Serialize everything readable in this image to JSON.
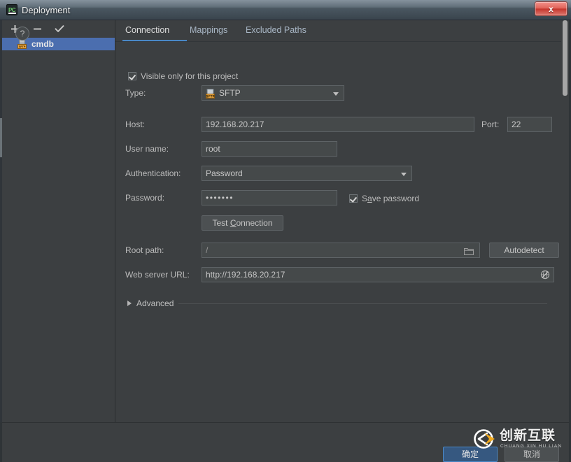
{
  "window": {
    "title": "Deployment",
    "app_icon": "pycharm-icon",
    "close_label": "x"
  },
  "sidebar": {
    "toolbar": [
      {
        "name": "add-server-button",
        "icon": "plus-icon",
        "label": "+"
      },
      {
        "name": "remove-server-button",
        "icon": "minus-icon",
        "label": "−"
      },
      {
        "name": "set-default-server-button",
        "icon": "check-icon",
        "label": "✓"
      }
    ],
    "servers": [
      {
        "label": "cmdb",
        "icon": "sftp-server-icon",
        "badge": "SFTP",
        "selected": true
      }
    ]
  },
  "tabs": [
    {
      "label": "Connection",
      "active": true
    },
    {
      "label": "Mappings",
      "active": false
    },
    {
      "label": "Excluded Paths",
      "active": false
    }
  ],
  "form": {
    "visible_only": {
      "label": "Visible only for this project",
      "checked": true
    },
    "type": {
      "label": "Type:",
      "value": "SFTP",
      "icon": "sftp-type-icon"
    },
    "host": {
      "label": "Host:",
      "value": "192.168.20.217"
    },
    "port": {
      "label": "Port:",
      "value": "22"
    },
    "user_name": {
      "label": "User name:",
      "value": "root"
    },
    "authentication": {
      "label": "Authentication:",
      "value": "Password"
    },
    "password": {
      "label": "Password:",
      "value": "•••••••"
    },
    "save_password": {
      "label_pre": "S",
      "label_mnemonic": "a",
      "label_post": "ve password",
      "checked": true
    },
    "test_connection": {
      "label_pre": "Test ",
      "label_mnemonic": "C",
      "label_post": "onnection"
    },
    "root_path": {
      "label": "Root path:",
      "value": "/",
      "browse_icon": "folder-icon"
    },
    "autodetect": {
      "label": "Autodetect"
    },
    "web_server_url": {
      "label": "Web server URL:",
      "value": "http://192.168.20.217",
      "open_icon": "globe-icon"
    },
    "advanced": {
      "label": "Advanced",
      "expanded": false,
      "icon": "triangle-right-icon"
    }
  },
  "footer": {
    "help_label": "?",
    "ok_label": "确定",
    "cancel_label": "取消"
  },
  "watermark": {
    "logo_icon": "cx-circle-logo",
    "cn_text": "创新互联",
    "en_text": "CHUANG XIN HU LIAN"
  },
  "colors": {
    "panel_bg": "#3c3f41",
    "field_bg": "#45494a",
    "selection_blue": "#4b6eaf",
    "accent_blue": "#4a88c7",
    "primary_button_bg": "#365880",
    "text": "#bbbbbb",
    "close_red": "#c3332a"
  }
}
